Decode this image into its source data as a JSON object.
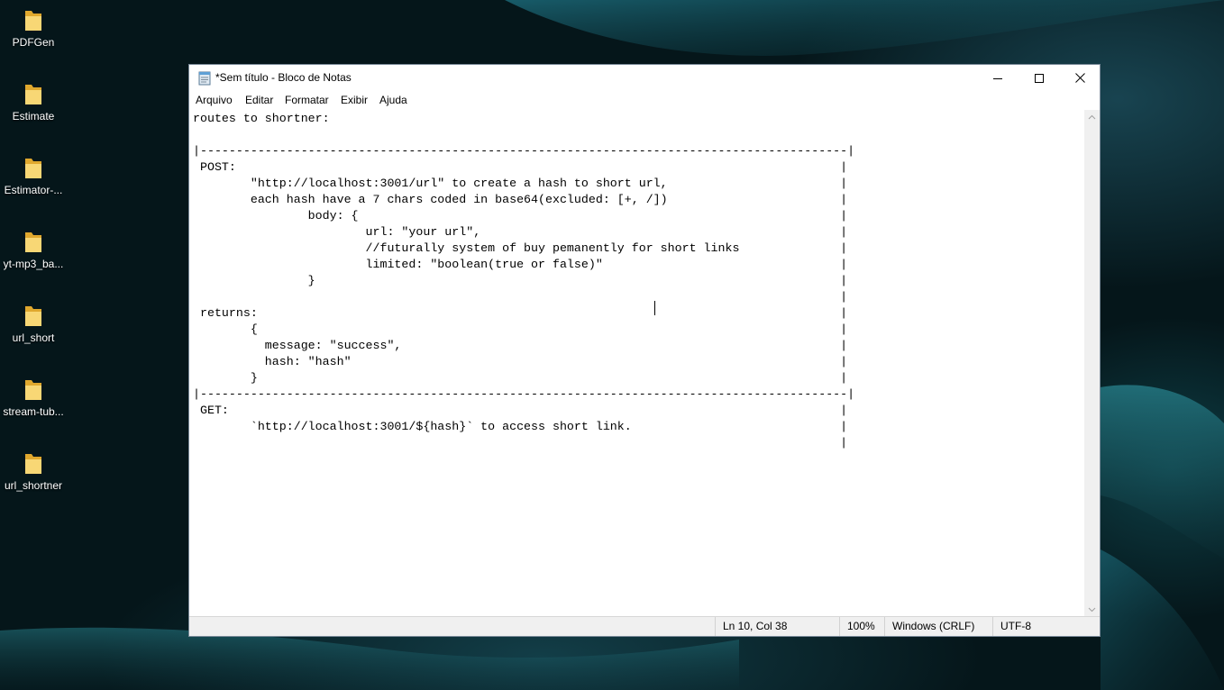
{
  "desktop": {
    "icons": [
      {
        "label": "PDFGen",
        "icon": "folder-icon"
      },
      {
        "label": "Estimate",
        "icon": "folder-icon"
      },
      {
        "label": "Estimator-...",
        "icon": "folder-icon"
      },
      {
        "label": "yt-mp3_ba...",
        "icon": "folder-icon"
      },
      {
        "label": "url_short",
        "icon": "folder-icon"
      },
      {
        "label": "stream-tub...",
        "icon": "folder-icon"
      },
      {
        "label": "url_shortner",
        "icon": "folder-icon"
      }
    ]
  },
  "window": {
    "title": "*Sem título - Bloco de Notas",
    "app_icon": "notepad-icon",
    "controls": {
      "minimize": "minimize-icon",
      "maximize": "maximize-icon",
      "close": "close-icon"
    },
    "menu": {
      "file": "Arquivo",
      "edit": "Editar",
      "format": "Formatar",
      "view": "Exibir",
      "help": "Ajuda"
    },
    "editor": {
      "content": "routes to shortner:\n\n|------------------------------------------------------------------------------------------|\n POST:                                                                                    |\n        \"http://localhost:3001/url\" to create a hash to short url,                        |\n        each hash have a 7 chars coded in base64(excluded: [+, /])                        |\n                body: {                                                                   |\n                        url: \"your url\",                                                  |\n                        //futurally system of buy pemanently for short links              |\n                        limited: \"boolean(true or false)\"                                 |\n                }                                                                         |\n                                                                                          |\n returns:                                                                                 |\n        {                                                                                 |\n          message: \"success\",                                                             |\n          hash: \"hash\"                                                                    |\n        }                                                                                 |\n|------------------------------------------------------------------------------------------|\n GET:                                                                                     |\n        `http://localhost:3001/${hash}` to access short link.                             |\n                                                                                          |"
    },
    "status": {
      "position": "Ln 10, Col 38",
      "zoom": "100%",
      "line_ending": "Windows (CRLF)",
      "encoding": "UTF-8"
    }
  },
  "colors": {
    "folder": "#f5c542",
    "desktop_bg": "#05161a",
    "window_bg": "#ffffff",
    "statusbar_bg": "#f0f0f0"
  }
}
